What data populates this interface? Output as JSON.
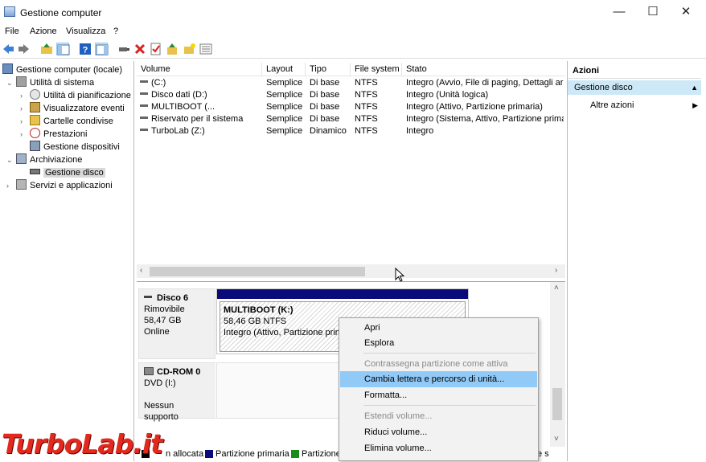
{
  "window": {
    "title": "Gestione computer",
    "controls": [
      "—",
      "☐",
      "✕"
    ]
  },
  "menu": [
    "File",
    "Azione",
    "Visualizza",
    "?"
  ],
  "tree": [
    {
      "label": "Gestione computer (locale)"
    },
    {
      "label": "Utilità di sistema"
    },
    {
      "label": "Utilità di pianificazione"
    },
    {
      "label": "Visualizzatore eventi"
    },
    {
      "label": "Cartelle condivise"
    },
    {
      "label": "Prestazioni"
    },
    {
      "label": "Gestione dispositivi"
    },
    {
      "label": "Archiviazione"
    },
    {
      "label": "Gestione disco"
    },
    {
      "label": "Servizi e applicazioni"
    }
  ],
  "volumes": {
    "columns": [
      "Volume",
      "Layout",
      "Tipo",
      "File system",
      "Stato"
    ],
    "rows": [
      [
        "(C:)",
        "Semplice",
        "Di base",
        "NTFS",
        "Integro (Avvio, File di paging, Dettagli arr"
      ],
      [
        "Disco dati (D:)",
        "Semplice",
        "Di base",
        "NTFS",
        "Integro (Unità logica)"
      ],
      [
        "MULTIBOOT (...",
        "Semplice",
        "Di base",
        "NTFS",
        "Integro (Attivo, Partizione primaria)"
      ],
      [
        "Riservato per il sistema",
        "Semplice",
        "Di base",
        "NTFS",
        "Integro (Sistema, Attivo, Partizione primar"
      ],
      [
        "TurboLab (Z:)",
        "Semplice",
        "Dinamico",
        "NTFS",
        "Integro"
      ]
    ]
  },
  "disks": [
    {
      "name": "Disco 6",
      "type": "Rimovibile",
      "size": "58,47 GB",
      "status": "Online"
    },
    {
      "name": "CD-ROM 0",
      "type": "DVD (I:)",
      "status": "Nessun supporto"
    }
  ],
  "partition": {
    "title": "MULTIBOOT  (K:)",
    "size": "58,46 GB NTFS",
    "status": "Integro (Attivo, Partizione prim"
  },
  "legend": [
    {
      "label": "Non allocata",
      "visible": "n allocata",
      "color": "#000000"
    },
    {
      "label": "Partizione primaria",
      "color": "#0a0a7a"
    },
    {
      "label": "Partizione",
      "color": "#1a8a1a"
    }
  ],
  "actions": {
    "header": "Azioni",
    "section": "Gestione disco",
    "item": "Altre azioni"
  },
  "context_menu": [
    {
      "label": "Apri",
      "state": "enabled"
    },
    {
      "label": "Esplora",
      "state": "enabled"
    },
    {
      "label": "Contrassegna partizione come attiva",
      "state": "disabled"
    },
    {
      "label": "Cambia lettera e percorso di unità...",
      "state": "highlighted"
    },
    {
      "label": "Formatta...",
      "state": "enabled"
    },
    {
      "label": "Estendi volume...",
      "state": "disabled"
    },
    {
      "label": "Riduci volume...",
      "state": "enabled"
    },
    {
      "label": "Elimina volume...",
      "state": "enabled"
    }
  ],
  "watermark": "TurboLab.it"
}
